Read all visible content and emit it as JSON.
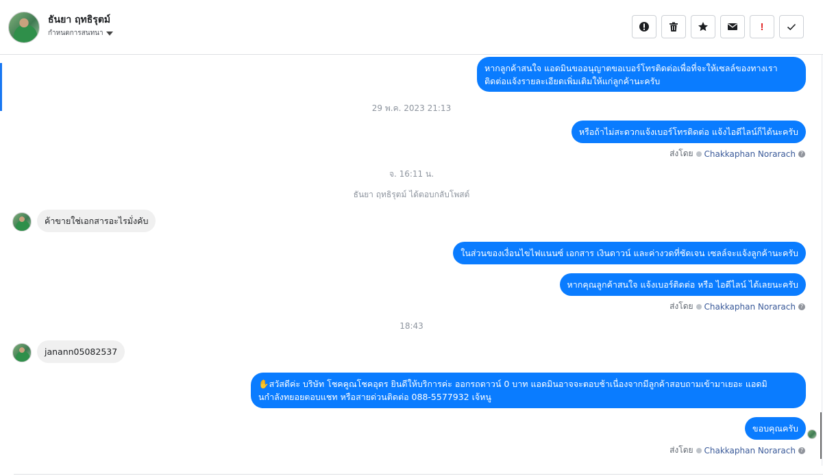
{
  "header": {
    "contact_name": "ธันยา ฤทธิรุตม์",
    "status_label": "กำหนดการสนทนา",
    "toolbar": {
      "icons": [
        "info-icon",
        "trash-icon",
        "star-icon",
        "mail-icon",
        "exclamation-icon",
        "check-icon"
      ]
    }
  },
  "conversation": {
    "msg1": "หากลูกค้าสนใจ แอดมินขออนุญาตขอเบอร์โทรติดต่อเพื่อที่จะให้เซลล์ของทางเรา",
    "msg1_line2": "ติดต่อแจ้งรายละเอียดเพิ่มเติมให้แก่ลูกค้านะครับ",
    "timestamp1": "29 พ.ค. 2023 21:13",
    "msg2": "หรือถ้าไม่สะดวกแจ้งเบอร์โทรติดต่อ แจ้งไอดีไลน์ก็ได้นะครับ",
    "sent_by_label": "ส่งโดย",
    "agent_name": "Chakkaphan Norarach",
    "timestamp2": "จ. 16:11 น.",
    "event_text": "ธันยา ฤทธิรุตม์ ได้ตอบกลับโพสต์",
    "msg3": "ค้าขายใช่เอกสารอะไรมั่งคับ",
    "msg4": "ในส่วนของเงื่อนไขไฟแนนซ์ เอกสาร เงินดาวน์ และค่างวดที่ชัดเจน เซลล์จะแจ้งลูกค้านะครับ",
    "msg5": "หากคุณลูกค้าสนใจ แจ้งเบอร์ติดต่อ หรือ ไอดีไลน์ ได้เลยนะครับ",
    "timestamp3": "18:43",
    "msg6": "janann05082537",
    "msg7": "✋สวัสดีค่ะ บริษัท โชคคูณโชคอุดร ยินดีให้บริการค่ะ ออกรถดาวน์ 0 บาท แอดมินอาจจะตอบช้าเนื่องจากมีลูกค้าสอบถามเข้ามาเยอะ แอดมิ",
    "msg7_line2": "นกำลังทยอยตอบแชท หรือสายด่วนติดต่อ 088-5577932 เจ้หนู",
    "msg8": "ขอบคุณครับ"
  },
  "colors": {
    "outgoing_bubble": "#0a7cff",
    "incoming_bubble": "#f0f0f0",
    "agent_link": "#385898",
    "accent": "#1877f2"
  }
}
